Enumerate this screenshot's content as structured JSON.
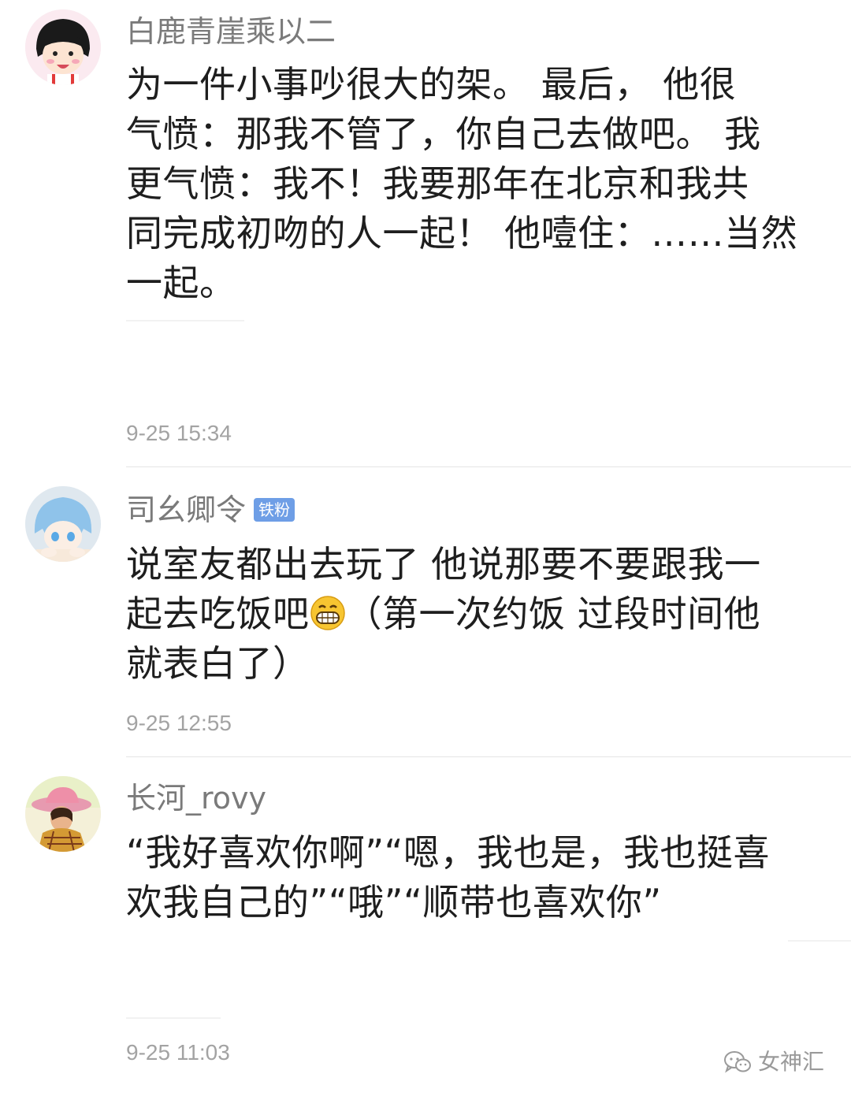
{
  "comments": [
    {
      "username": "白鹿青崖乘以二",
      "lines": [
        "为一件小事吵很大的架。 最后， 他很",
        "气愤：那我不管了，你自己去做吧。 我",
        "更气愤：我不！我要那年在北京和我共",
        "同完成初吻的人一起！ 他噎住：……当然",
        "一起。"
      ],
      "time": "9-25 15:34",
      "avatar_icon": "cartoon-girl-avatar"
    },
    {
      "username": "司幺卿令",
      "badge": "铁粉",
      "lines": [
        "说室友都出去玩了 他说那要不要跟我一",
        "起去吃饭吧",
        "（第一次约饭 过段时间他",
        "就表白了）"
      ],
      "emoji": "grinning-face-emoji",
      "time": "9-25 12:55",
      "avatar_icon": "anime-boy-avatar"
    },
    {
      "username": "长河_rovy",
      "lines": [
        "“我好喜欢你啊”“嗯，我也是，我也挺喜",
        "欢我自己的”“哦”“顺带也喜欢你”"
      ],
      "time": "9-25 11:03",
      "avatar_icon": "girl-in-pink-hat-avatar"
    }
  ],
  "watermark": {
    "text": "女神汇",
    "icon": "wechat-icon"
  },
  "colors": {
    "username": "#7a7a7a",
    "body": "#1e1e1e",
    "timestamp": "#a3a3a3",
    "badge": "#6e9ee6",
    "divider": "#e4e4e4"
  }
}
